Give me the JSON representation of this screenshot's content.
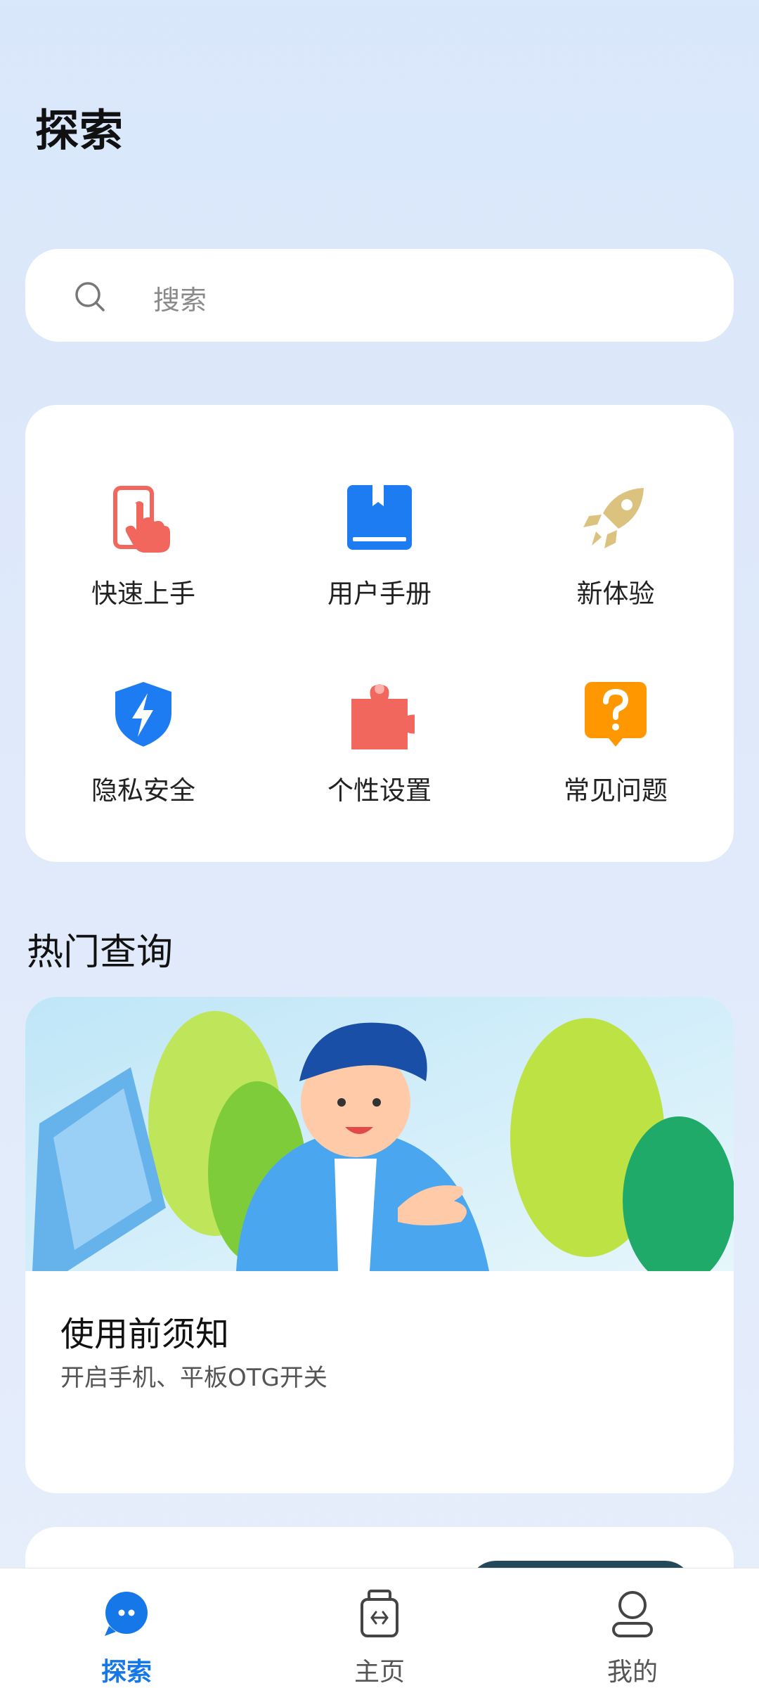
{
  "header": {
    "title": "探索"
  },
  "search": {
    "placeholder": "搜索",
    "icon": "search-icon"
  },
  "quick_links": [
    {
      "label": "快速上手",
      "icon": "tap-hand-icon",
      "color": "#f2675d"
    },
    {
      "label": "用户手册",
      "icon": "book-icon",
      "color": "#1d7cf2"
    },
    {
      "label": "新体验",
      "icon": "rocket-icon",
      "color": "#dcc27f"
    },
    {
      "label": "隐私安全",
      "icon": "shield-bolt-icon",
      "color": "#1d7cf2"
    },
    {
      "label": "个性设置",
      "icon": "puzzle-icon",
      "color": "#f2675d"
    },
    {
      "label": "常见问题",
      "icon": "question-bubble-icon",
      "color": "#ff9800"
    }
  ],
  "hot": {
    "section_title": "热门查询",
    "article": {
      "title": "使用前须知",
      "subtitle": "开启手机、平板OTG开关"
    }
  },
  "bottom_nav": [
    {
      "label": "探索",
      "icon": "chat-bubble-icon",
      "active": true
    },
    {
      "label": "主页",
      "icon": "usb-device-icon",
      "active": false
    },
    {
      "label": "我的",
      "icon": "person-icon",
      "active": false
    }
  ],
  "colors": {
    "accent": "#1677e8",
    "background": "#dfe9fa"
  }
}
